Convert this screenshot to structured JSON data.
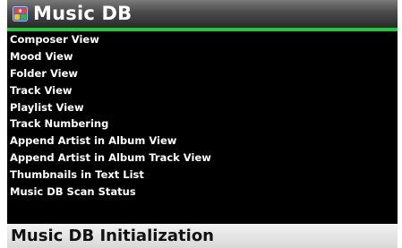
{
  "header": {
    "title": "Music DB",
    "icon": "music-db-icon"
  },
  "colors": {
    "accent": "#22c83a",
    "background": "#000000",
    "selected_background": "#e6e6e6"
  },
  "menu": {
    "items": [
      {
        "label": "Composer View"
      },
      {
        "label": "Mood View"
      },
      {
        "label": "Folder View"
      },
      {
        "label": "Track View"
      },
      {
        "label": "Playlist View"
      },
      {
        "label": "Track Numbering"
      },
      {
        "label": "Append Artist in Album View"
      },
      {
        "label": "Append Artist in Album Track View"
      },
      {
        "label": "Thumbnails in Text List"
      },
      {
        "label": "Music DB Scan Status"
      }
    ],
    "selected": {
      "label": "Music DB Initialization"
    }
  }
}
